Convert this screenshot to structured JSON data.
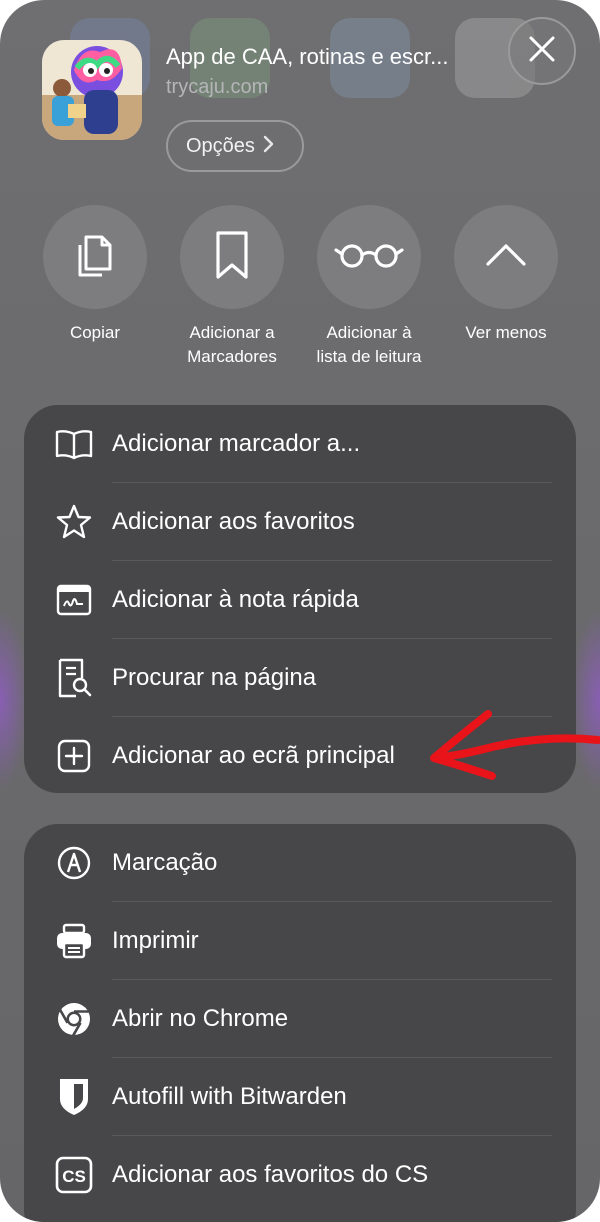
{
  "header": {
    "title": "App de CAA, rotinas e escr...",
    "url": "trycaju.com",
    "options_label": "Opções"
  },
  "quick_actions": [
    {
      "icon": "copy-icon",
      "label_line1": "Copiar",
      "label_line2": ""
    },
    {
      "icon": "bookmark-icon",
      "label_line1": "Adicionar a",
      "label_line2": "Marcadores"
    },
    {
      "icon": "reading-list-icon",
      "label_line1": "Adicionar à",
      "label_line2": "lista de leitura"
    },
    {
      "icon": "chevron-up-icon",
      "label_line1": "Ver menos",
      "label_line2": ""
    }
  ],
  "menu_group_1": [
    {
      "icon": "book-icon",
      "label": "Adicionar marcador a..."
    },
    {
      "icon": "star-icon",
      "label": "Adicionar aos favoritos"
    },
    {
      "icon": "quick-note-icon",
      "label": "Adicionar à nota rápida"
    },
    {
      "icon": "find-in-page-icon",
      "label": "Procurar na página"
    },
    {
      "icon": "add-square-icon",
      "label": "Adicionar ao ecrã principal"
    }
  ],
  "menu_group_2": [
    {
      "icon": "markup-icon",
      "label": "Marcação"
    },
    {
      "icon": "printer-icon",
      "label": "Imprimir"
    },
    {
      "icon": "chrome-icon",
      "label": "Abrir no Chrome"
    },
    {
      "icon": "bitwarden-shield-icon",
      "label": "Autofill with Bitwarden"
    },
    {
      "icon": "cs-icon",
      "label": "Adicionar aos favoritos do CS"
    }
  ],
  "colors": {
    "sheet_background": "#6d6d6f",
    "menu_group_background": "#474749",
    "action_circle": "#7d7d80",
    "annotation_arrow": "#e8141a"
  }
}
